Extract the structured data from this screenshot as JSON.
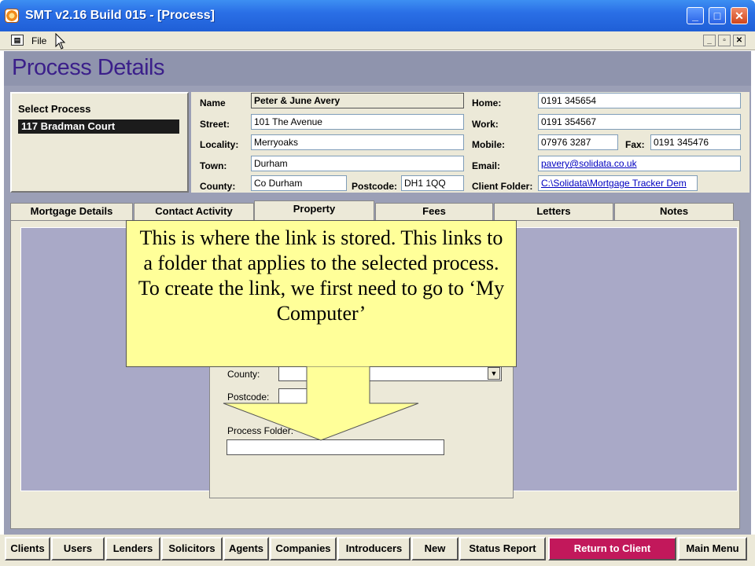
{
  "window": {
    "title": "SMT v2.16 Build 015 - [Process]"
  },
  "menu": {
    "file": "File",
    "form_icon": "form-icon"
  },
  "page": {
    "title": "Process Details"
  },
  "select_process": {
    "label": "Select Process",
    "items": [
      "117 Bradman Court"
    ]
  },
  "client": {
    "name_label": "Name",
    "name": "Peter & June Avery",
    "street_label": "Street:",
    "street": "101 The Avenue",
    "locality_label": "Locality:",
    "locality": "Merryoaks",
    "town_label": "Town:",
    "town": "Durham",
    "county_label": "County:",
    "county": "Co Durham",
    "postcode_label": "Postcode:",
    "postcode": "DH1 1QQ",
    "home_label": "Home:",
    "home": "0191 345654",
    "work_label": "Work:",
    "work": "0191 354567",
    "mobile_label": "Mobile:",
    "mobile": "07976 3287",
    "fax_label": "Fax:",
    "fax": "0191 345476",
    "email_label": "Email:",
    "email": "pavery@solidata.co.uk",
    "folder_label": "Client Folder:",
    "folder": "C:\\Solidata\\Mortgage Tracker Dem"
  },
  "tabs": [
    "Mortgage Details",
    "Contact Activity",
    "Property",
    "Fees",
    "Letters",
    "Notes"
  ],
  "property": {
    "county_label": "County:",
    "postcode_label": "Postcode:",
    "folder_label": "Process Folder:"
  },
  "callout": {
    "text": "This is where the link is stored. This links to a folder that applies to the selected process. To create the link, we first need to go to ‘My Computer’"
  },
  "buttons": [
    "Clients",
    "Users",
    "Lenders",
    "Solicitors",
    "Agents",
    "Companies",
    "Introducers",
    "New",
    "Status Report",
    "Return to Client",
    "Main Menu"
  ],
  "colors": {
    "accent_button": "#c2185b",
    "title_text": "#3b1f8a",
    "callout": "#ffff99"
  }
}
